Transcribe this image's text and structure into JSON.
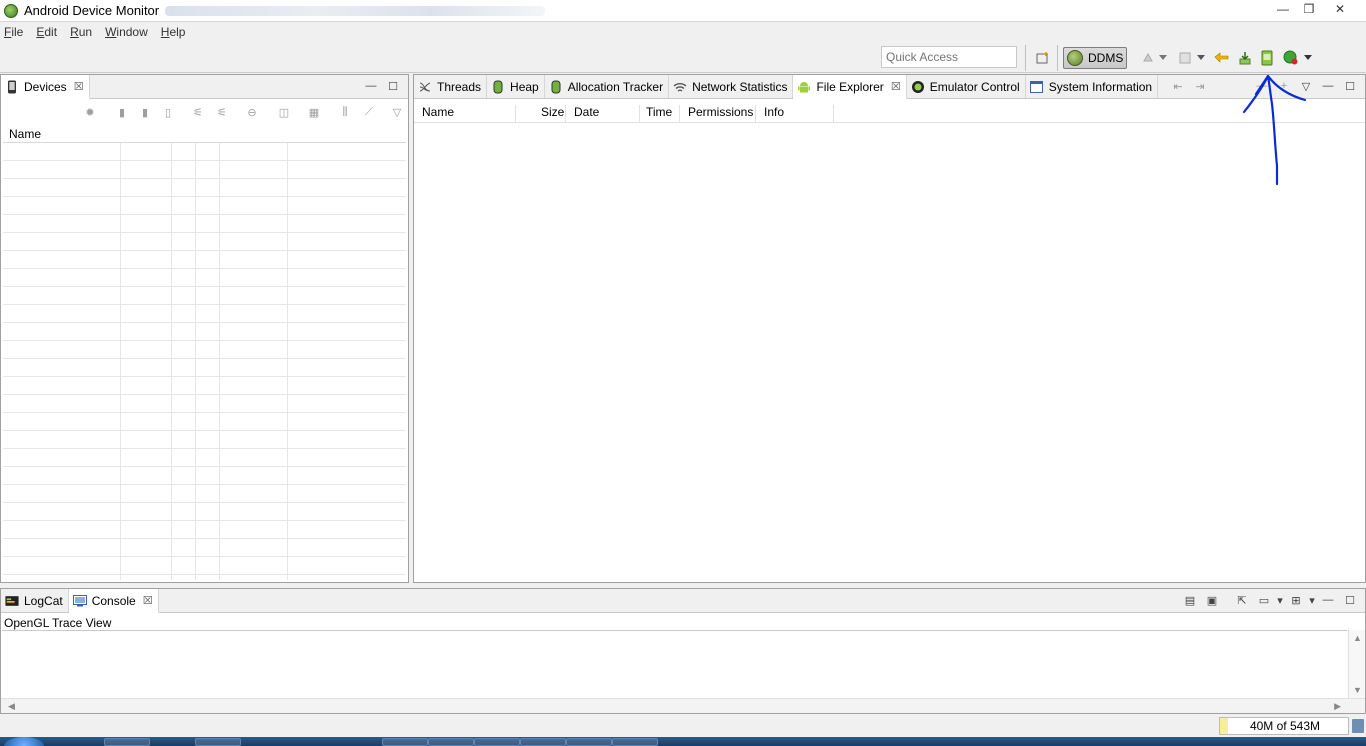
{
  "window": {
    "title": "Android Device Monitor",
    "controls": {
      "minimize": "—",
      "maximize": "❐",
      "close": "✕"
    }
  },
  "menubar": [
    "File",
    "Edit",
    "Run",
    "Window",
    "Help"
  ],
  "toolbar": {
    "quick_access_placeholder": "Quick Access",
    "perspective": "DDMS"
  },
  "devices_panel": {
    "tab_label": "Devices",
    "column_header": "Name"
  },
  "main_panel": {
    "tabs": [
      {
        "label": "Threads",
        "icon": "threads-icon"
      },
      {
        "label": "Heap",
        "icon": "heap-icon"
      },
      {
        "label": "Allocation Tracker",
        "icon": "allocation-icon"
      },
      {
        "label": "Network Statistics",
        "icon": "network-icon"
      },
      {
        "label": "File Explorer",
        "icon": "android-icon",
        "active": true
      },
      {
        "label": "Emulator Control",
        "icon": "emulator-icon"
      },
      {
        "label": "System Information",
        "icon": "window-icon"
      }
    ],
    "file_columns": [
      "Name",
      "Size",
      "Date",
      "Time",
      "Permissions",
      "Info"
    ]
  },
  "bottom_panel": {
    "tabs": [
      {
        "label": "LogCat",
        "icon": "logcat-icon"
      },
      {
        "label": "Console",
        "icon": "console-icon",
        "active": true
      }
    ],
    "console_title": "OpenGL Trace View"
  },
  "statusbar": {
    "heap_usage": "40M of 543M",
    "heap_fraction": 0.074
  },
  "annotation_color": "#0a2bd6"
}
